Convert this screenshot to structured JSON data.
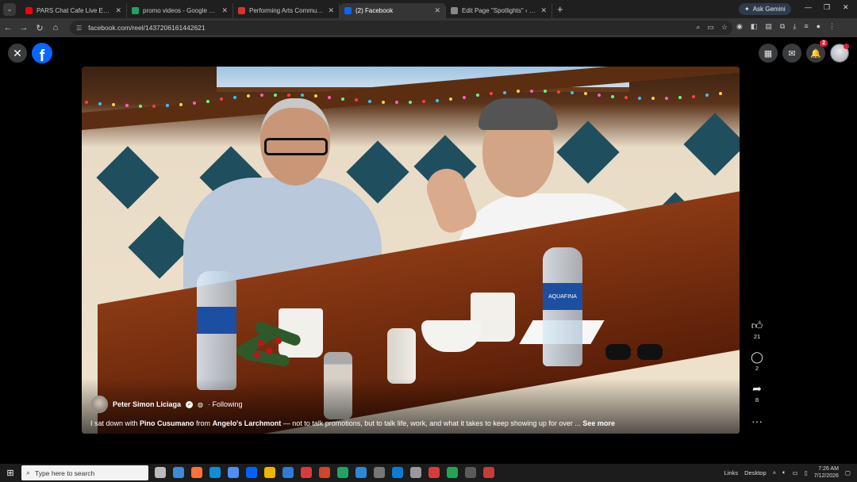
{
  "browser": {
    "tabs": [
      {
        "label": "PARS Chat Cafe Live Episode 0",
        "color": "#ff0000",
        "active": false
      },
      {
        "label": "promo videos - Google Drive",
        "color": "#1fa463",
        "active": false
      },
      {
        "label": "Performing Arts Community",
        "color": "#d8352a",
        "active": false
      },
      {
        "label": "(2) Facebook",
        "color": "#0866ff",
        "active": true
      },
      {
        "label": "Edit Page \"Spotlights\" ‹ Peter Li",
        "color": "#888888",
        "active": false
      }
    ],
    "gemini_label": "Ask Gemini",
    "url": "facebook.com/reel/1437206161442621"
  },
  "facebook": {
    "notification_count": "2",
    "post": {
      "author_name": "Peter Simon Liciaga",
      "follow_status": "· Following",
      "caption_prefix": "I sat down with ",
      "caption_mention1": "Pino Cusumano",
      "caption_mid": " from ",
      "caption_mention2": "Angelo's Larchmont",
      "caption_suffix": " — not to talk promotions, but to talk life, work, and what it takes to keep showing up for over ... ",
      "see_more": "See more",
      "bottle_label": "AQUAFINA"
    },
    "actions": {
      "likes": "21",
      "comments": "2",
      "shares": "8"
    }
  },
  "taskbar": {
    "search_placeholder": "Type here to search",
    "links_label": "Links",
    "desktop_label": "Desktop",
    "time": "7:26 AM",
    "date": "7/12/2026"
  }
}
